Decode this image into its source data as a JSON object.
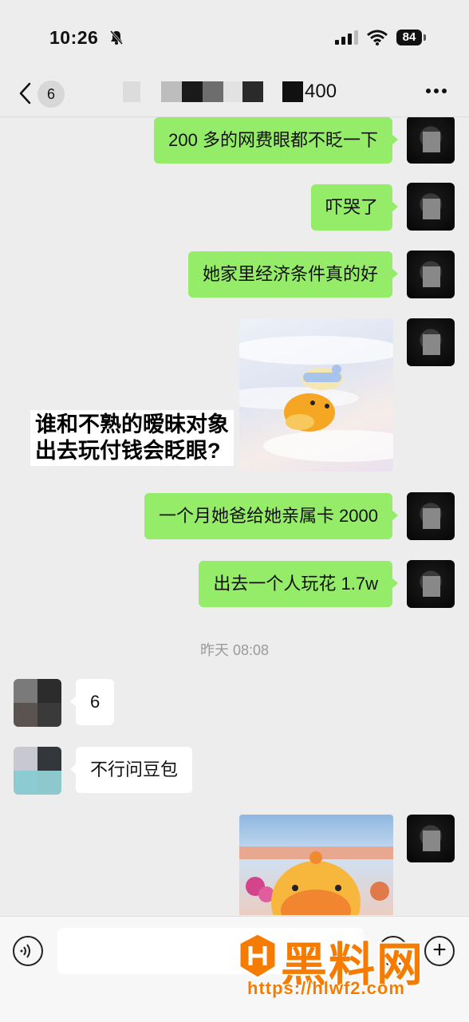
{
  "status_bar": {
    "time": "10:26",
    "battery": "84"
  },
  "header": {
    "unread_count": "6",
    "title_suffix": "400"
  },
  "messages": [
    {
      "side": "out",
      "text": "200 多的网费眼都不眨一下"
    },
    {
      "side": "out",
      "text": "吓哭了"
    },
    {
      "side": "out",
      "text": "她家里经济条件真的好"
    },
    {
      "side": "out",
      "type": "sticker",
      "caption": [
        "谁和不熟的暧昧对象",
        "出去玩付钱会眨眼?"
      ]
    },
    {
      "side": "out",
      "text": "一个月她爸给她亲属卡 2000"
    },
    {
      "side": "out",
      "text": "出去一个人玩花 1.7w"
    },
    {
      "type": "timestamp",
      "text": "昨天 08:08"
    },
    {
      "side": "in",
      "text": "6"
    },
    {
      "side": "in",
      "text": "不行问豆包"
    },
    {
      "side": "out",
      "type": "sticker"
    }
  ],
  "watermark": {
    "brand": "黑料网",
    "url": "https://hlwf2.com"
  },
  "colors": {
    "outgoing_bubble": "#95ec69",
    "incoming_bubble": "#ffffff",
    "background": "#ededed",
    "watermark": "#f57c00"
  }
}
